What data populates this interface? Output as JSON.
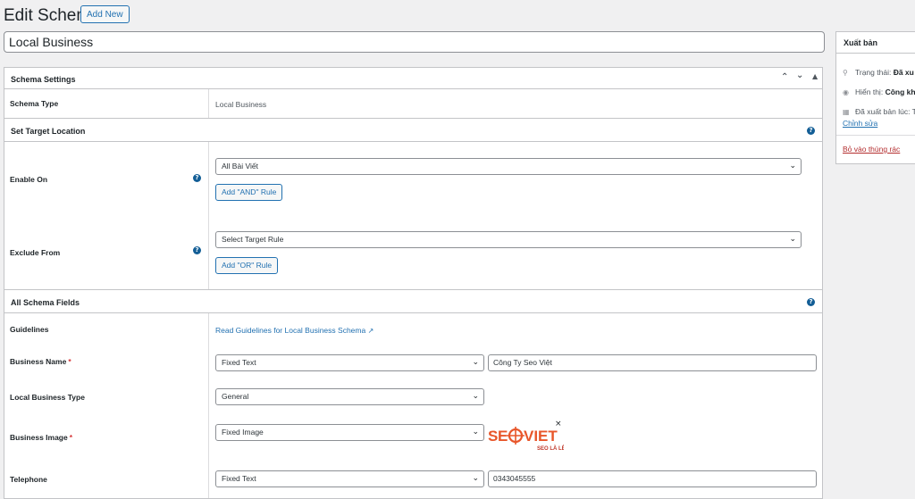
{
  "header": {
    "title": "Edit Schema",
    "add_new": "Add New"
  },
  "post_title": "Local Business",
  "schema_settings": {
    "title": "Schema Settings",
    "schema_type_label": "Schema Type",
    "schema_type_value": "Local Business"
  },
  "target_location": {
    "title": "Set Target Location",
    "enable_on_label": "Enable On",
    "enable_on_value": "All Bài Viết",
    "and_rule": "Add \"AND\" Rule",
    "exclude_from_label": "Exclude From",
    "exclude_from_value": "Select Target Rule",
    "or_rule": "Add \"OR\" Rule"
  },
  "fields": {
    "title": "All Schema Fields",
    "guidelines_label": "Guidelines",
    "guidelines_link": "Read Guidelines for Local Business Schema",
    "business_name_label": "Business Name",
    "business_name_type": "Fixed Text",
    "business_name_value": "Công Ty Seo Việt",
    "business_type_label": "Local Business Type",
    "business_type_value": "General",
    "business_image_label": "Business Image",
    "business_image_type": "Fixed Image",
    "telephone_label": "Telephone",
    "telephone_type": "Fixed Text",
    "telephone_value": "0343045555",
    "required_mark": "*"
  },
  "logo": {
    "brand_left": "S",
    "brand_right": "VIET",
    "tagline": "SEO LÀ LÊN",
    "remove": "×",
    "color": "#e8562a"
  },
  "publish": {
    "title": "Xuất bản",
    "status": "Trạng thái:",
    "status_value": "Đã xu",
    "visibility": "Hiển thị:",
    "visibility_value": "Công kh",
    "published_at": "Đã xuất bản lúc: T",
    "edit_link": "Chỉnh sửa",
    "trash_link": "Bỏ vào thùng rác"
  }
}
